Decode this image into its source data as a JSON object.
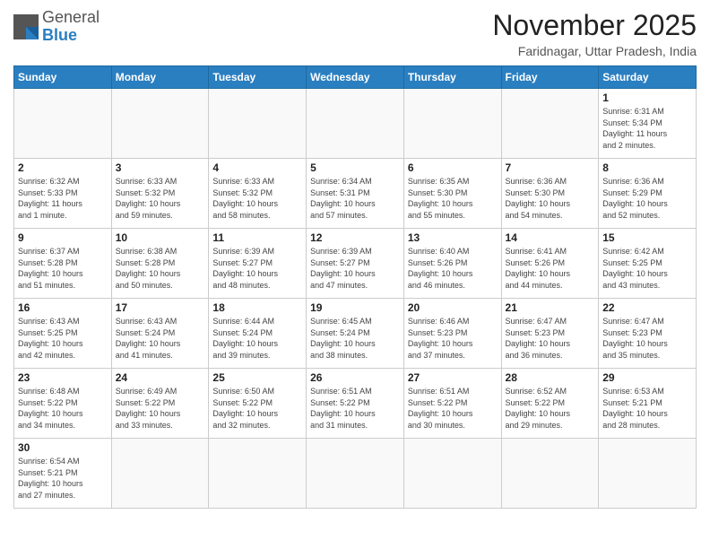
{
  "header": {
    "logo": {
      "general": "General",
      "blue": "Blue"
    },
    "title": "November 2025",
    "location": "Faridnagar, Uttar Pradesh, India"
  },
  "calendar": {
    "days_of_week": [
      "Sunday",
      "Monday",
      "Tuesday",
      "Wednesday",
      "Thursday",
      "Friday",
      "Saturday"
    ],
    "weeks": [
      [
        {
          "day": "",
          "info": ""
        },
        {
          "day": "",
          "info": ""
        },
        {
          "day": "",
          "info": ""
        },
        {
          "day": "",
          "info": ""
        },
        {
          "day": "",
          "info": ""
        },
        {
          "day": "",
          "info": ""
        },
        {
          "day": "1",
          "info": "Sunrise: 6:31 AM\nSunset: 5:34 PM\nDaylight: 11 hours\nand 2 minutes."
        }
      ],
      [
        {
          "day": "2",
          "info": "Sunrise: 6:32 AM\nSunset: 5:33 PM\nDaylight: 11 hours\nand 1 minute."
        },
        {
          "day": "3",
          "info": "Sunrise: 6:33 AM\nSunset: 5:32 PM\nDaylight: 10 hours\nand 59 minutes."
        },
        {
          "day": "4",
          "info": "Sunrise: 6:33 AM\nSunset: 5:32 PM\nDaylight: 10 hours\nand 58 minutes."
        },
        {
          "day": "5",
          "info": "Sunrise: 6:34 AM\nSunset: 5:31 PM\nDaylight: 10 hours\nand 57 minutes."
        },
        {
          "day": "6",
          "info": "Sunrise: 6:35 AM\nSunset: 5:30 PM\nDaylight: 10 hours\nand 55 minutes."
        },
        {
          "day": "7",
          "info": "Sunrise: 6:36 AM\nSunset: 5:30 PM\nDaylight: 10 hours\nand 54 minutes."
        },
        {
          "day": "8",
          "info": "Sunrise: 6:36 AM\nSunset: 5:29 PM\nDaylight: 10 hours\nand 52 minutes."
        }
      ],
      [
        {
          "day": "9",
          "info": "Sunrise: 6:37 AM\nSunset: 5:28 PM\nDaylight: 10 hours\nand 51 minutes."
        },
        {
          "day": "10",
          "info": "Sunrise: 6:38 AM\nSunset: 5:28 PM\nDaylight: 10 hours\nand 50 minutes."
        },
        {
          "day": "11",
          "info": "Sunrise: 6:39 AM\nSunset: 5:27 PM\nDaylight: 10 hours\nand 48 minutes."
        },
        {
          "day": "12",
          "info": "Sunrise: 6:39 AM\nSunset: 5:27 PM\nDaylight: 10 hours\nand 47 minutes."
        },
        {
          "day": "13",
          "info": "Sunrise: 6:40 AM\nSunset: 5:26 PM\nDaylight: 10 hours\nand 46 minutes."
        },
        {
          "day": "14",
          "info": "Sunrise: 6:41 AM\nSunset: 5:26 PM\nDaylight: 10 hours\nand 44 minutes."
        },
        {
          "day": "15",
          "info": "Sunrise: 6:42 AM\nSunset: 5:25 PM\nDaylight: 10 hours\nand 43 minutes."
        }
      ],
      [
        {
          "day": "16",
          "info": "Sunrise: 6:43 AM\nSunset: 5:25 PM\nDaylight: 10 hours\nand 42 minutes."
        },
        {
          "day": "17",
          "info": "Sunrise: 6:43 AM\nSunset: 5:24 PM\nDaylight: 10 hours\nand 41 minutes."
        },
        {
          "day": "18",
          "info": "Sunrise: 6:44 AM\nSunset: 5:24 PM\nDaylight: 10 hours\nand 39 minutes."
        },
        {
          "day": "19",
          "info": "Sunrise: 6:45 AM\nSunset: 5:24 PM\nDaylight: 10 hours\nand 38 minutes."
        },
        {
          "day": "20",
          "info": "Sunrise: 6:46 AM\nSunset: 5:23 PM\nDaylight: 10 hours\nand 37 minutes."
        },
        {
          "day": "21",
          "info": "Sunrise: 6:47 AM\nSunset: 5:23 PM\nDaylight: 10 hours\nand 36 minutes."
        },
        {
          "day": "22",
          "info": "Sunrise: 6:47 AM\nSunset: 5:23 PM\nDaylight: 10 hours\nand 35 minutes."
        }
      ],
      [
        {
          "day": "23",
          "info": "Sunrise: 6:48 AM\nSunset: 5:22 PM\nDaylight: 10 hours\nand 34 minutes."
        },
        {
          "day": "24",
          "info": "Sunrise: 6:49 AM\nSunset: 5:22 PM\nDaylight: 10 hours\nand 33 minutes."
        },
        {
          "day": "25",
          "info": "Sunrise: 6:50 AM\nSunset: 5:22 PM\nDaylight: 10 hours\nand 32 minutes."
        },
        {
          "day": "26",
          "info": "Sunrise: 6:51 AM\nSunset: 5:22 PM\nDaylight: 10 hours\nand 31 minutes."
        },
        {
          "day": "27",
          "info": "Sunrise: 6:51 AM\nSunset: 5:22 PM\nDaylight: 10 hours\nand 30 minutes."
        },
        {
          "day": "28",
          "info": "Sunrise: 6:52 AM\nSunset: 5:22 PM\nDaylight: 10 hours\nand 29 minutes."
        },
        {
          "day": "29",
          "info": "Sunrise: 6:53 AM\nSunset: 5:21 PM\nDaylight: 10 hours\nand 28 minutes."
        }
      ],
      [
        {
          "day": "30",
          "info": "Sunrise: 6:54 AM\nSunset: 5:21 PM\nDaylight: 10 hours\nand 27 minutes."
        },
        {
          "day": "",
          "info": ""
        },
        {
          "day": "",
          "info": ""
        },
        {
          "day": "",
          "info": ""
        },
        {
          "day": "",
          "info": ""
        },
        {
          "day": "",
          "info": ""
        },
        {
          "day": "",
          "info": ""
        }
      ]
    ]
  }
}
